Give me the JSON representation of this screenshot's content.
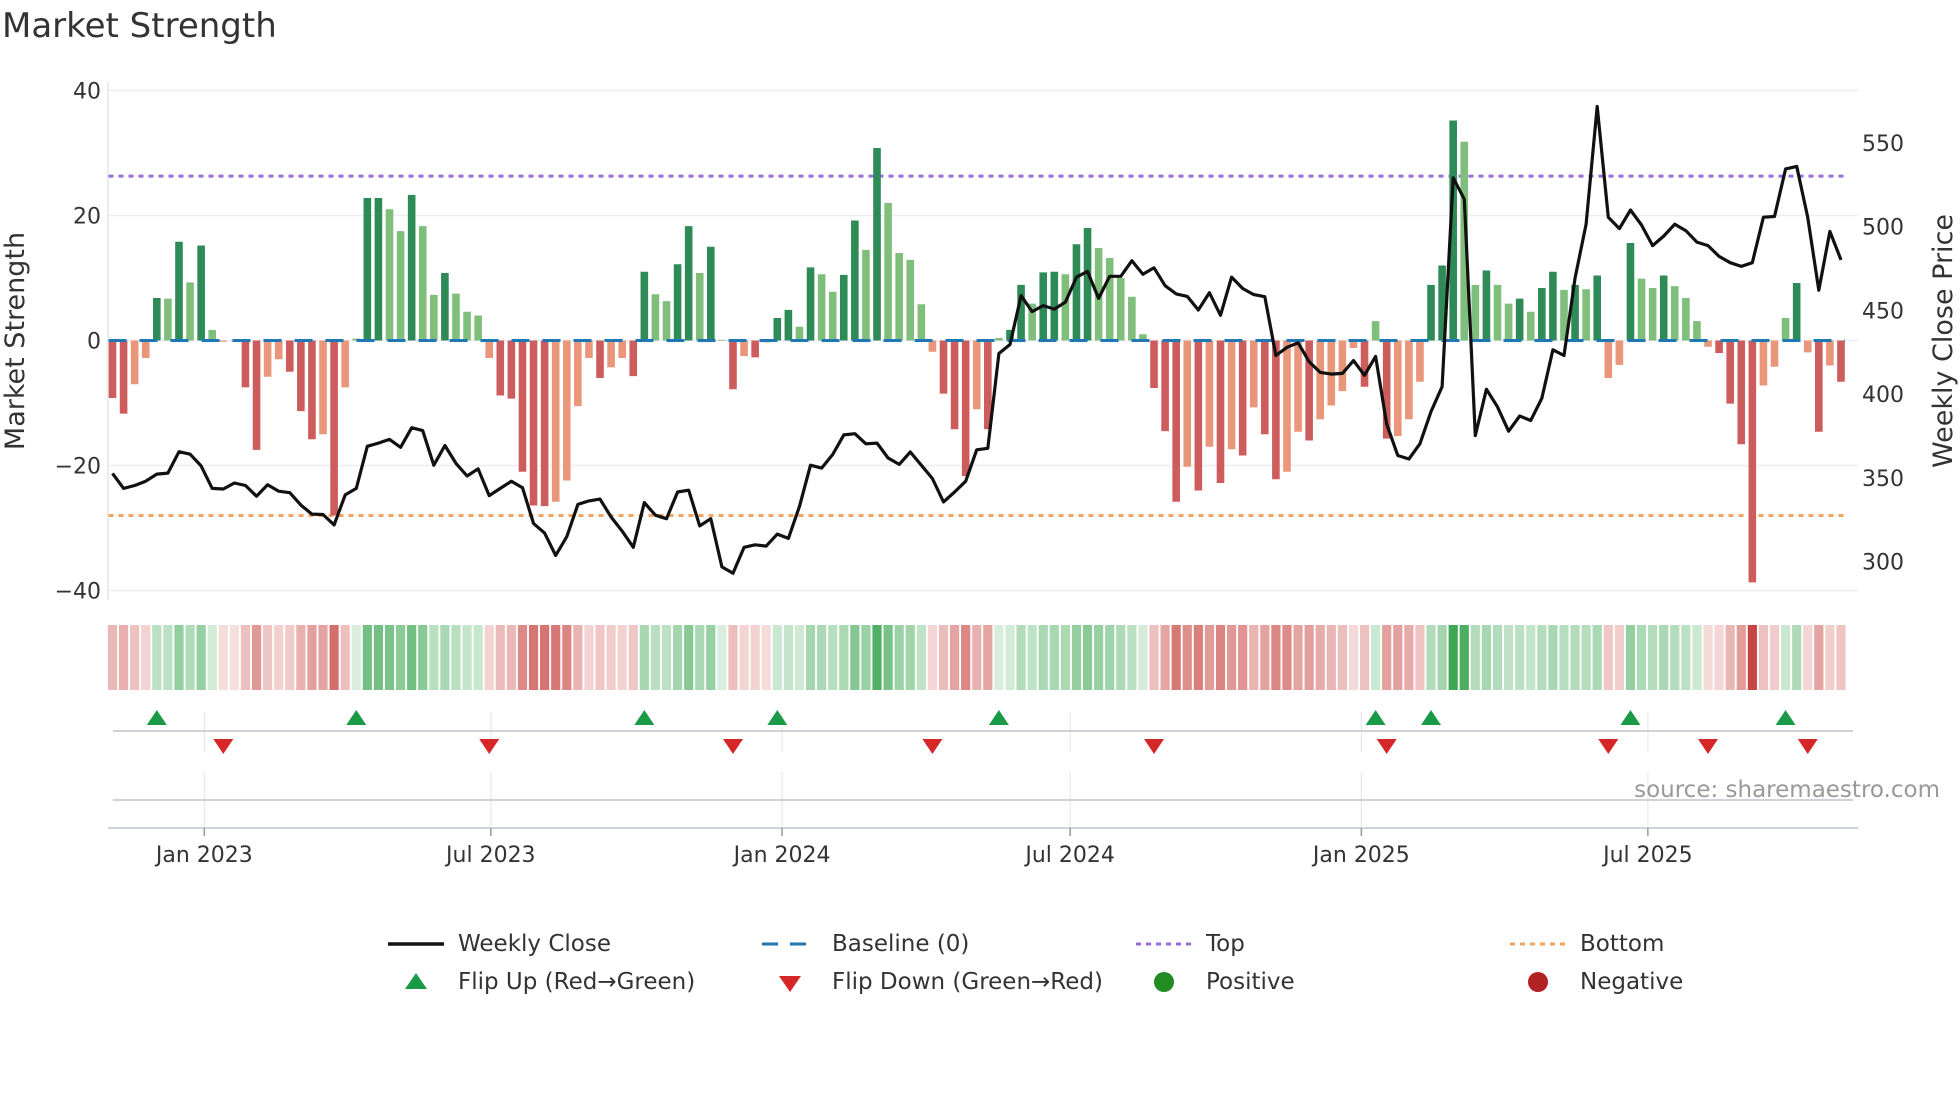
{
  "title": "Market Strength",
  "source": "source: sharemaestro.com",
  "legend": {
    "weekly_close": "Weekly Close",
    "baseline": "Baseline (0)",
    "top": "Top",
    "bottom": "Bottom",
    "flip_up": "Flip Up (Red→Green)",
    "flip_down": "Flip Down (Green→Red)",
    "positive": "Positive",
    "negative": "Negative"
  },
  "colors": {
    "strong_green": "#2e8b57",
    "weak_green": "#7fbf7b",
    "strong_red": "#cd5c5c",
    "weak_red": "#e9967a",
    "line": "#111111",
    "baseline": "#1f77b4",
    "top": "#9b6ee0",
    "bottom": "#f4a460",
    "flip_up": "#1a9a46",
    "flip_down": "#d62728",
    "positive": "#228b22",
    "negative": "#b22222",
    "grid": "#eceef3"
  },
  "chart_data": {
    "type": "bar+line",
    "title": "Market Strength",
    "xlabel": "",
    "ylabel": "Market Strength",
    "y2label": "Weekly Close Price",
    "start_date": "2022-11-04",
    "frequency": "weekly",
    "ylim": [
      -40,
      40
    ],
    "y2lim": [
      283.4,
      581.5
    ],
    "grid": true,
    "legend_position": "bottom",
    "y_ticks": [
      {
        "v": -40,
        "label": "−40"
      },
      {
        "v": -20,
        "label": "−20"
      },
      {
        "v": 0,
        "label": "0"
      },
      {
        "v": 20,
        "label": "20"
      },
      {
        "v": 40,
        "label": "40"
      }
    ],
    "y2_ticks": [
      {
        "v": 300,
        "label": "300"
      },
      {
        "v": 350,
        "label": "350"
      },
      {
        "v": 400,
        "label": "400"
      },
      {
        "v": 450,
        "label": "450"
      },
      {
        "v": 500,
        "label": "500"
      },
      {
        "v": 550,
        "label": "550"
      }
    ],
    "x_ticks": [
      {
        "date": "2023-01-01",
        "label": "Jan 2023"
      },
      {
        "date": "2023-07-01",
        "label": "Jul 2023"
      },
      {
        "date": "2024-01-01",
        "label": "Jan 2024"
      },
      {
        "date": "2024-07-01",
        "label": "Jul 2024"
      },
      {
        "date": "2025-01-01",
        "label": "Jan 2025"
      },
      {
        "date": "2025-07-01",
        "label": "Jul 2025"
      }
    ],
    "top_level": 26.3,
    "bottom_level": -28.0,
    "baseline": 0,
    "strength": [
      -9.2,
      -11.7,
      -7,
      -2.8,
      6.8,
      6.7,
      15.8,
      9.3,
      15.2,
      1.7,
      -0.2,
      -0.1,
      -7.5,
      -17.5,
      -5.8,
      -3,
      -5,
      -11.3,
      -15.8,
      -15,
      -28,
      -7.5,
      0.3,
      22.8,
      22.8,
      21,
      17.5,
      23.3,
      18.3,
      7.3,
      10.8,
      7.5,
      4.6,
      4,
      -2.8,
      -8.8,
      -9.3,
      -21,
      -26.4,
      -26.5,
      -25.8,
      -22.4,
      -10.5,
      -2.8,
      -6,
      -4.3,
      -2.8,
      -5.7,
      11,
      7.4,
      6.3,
      12.2,
      18.3,
      10.8,
      15,
      0.1,
      -7.8,
      -2.5,
      -2.7,
      -0.3,
      3.6,
      4.9,
      2.2,
      11.7,
      10.6,
      7.8,
      10.5,
      19.2,
      14.5,
      30.8,
      22,
      14,
      12.9,
      5.8,
      -1.8,
      -8.5,
      -14.2,
      -21.7,
      -11,
      -14.2,
      0.4,
      1.7,
      8.9,
      5.9,
      10.9,
      11,
      10.6,
      15.4,
      18,
      14.8,
      13.2,
      10,
      7,
      1,
      -7.6,
      -14.5,
      -25.8,
      -20.2,
      -24,
      -17,
      -22.8,
      -17.4,
      -18.4,
      -10.7,
      -15,
      -22.2,
      -21,
      -14.6,
      -16,
      -12.6,
      -10.4,
      -8.1,
      -1.2,
      -7.4,
      3.1,
      -15.7,
      -15.3,
      -12.6,
      -6.6,
      8.9,
      12,
      35.2,
      31.8,
      8.9,
      11.2,
      8.9,
      5.9,
      6.7,
      4.6,
      8.4,
      11,
      8.1,
      8.9,
      8.2,
      10.4,
      -6,
      -3.9,
      15.6,
      9.9,
      8.4,
      10.4,
      8.7,
      6.8,
      3.1,
      -1,
      -2,
      -10.1,
      -16.6,
      -38.7,
      -7.2,
      -4.2,
      3.6,
      9.2,
      -1.9,
      -14.6,
      -4,
      -6.6
    ],
    "weekly_close": [
      352.6,
      343.7,
      345.4,
      348,
      352.2,
      352.8,
      365.6,
      364.1,
      357.1,
      343.7,
      343.3,
      346.9,
      345.4,
      339,
      345.8,
      342,
      341.1,
      333.7,
      328.3,
      328.1,
      321.9,
      339.8,
      343.7,
      368.8,
      370.7,
      372.9,
      368.2,
      379.9,
      378.2,
      357.5,
      369.3,
      358.6,
      351.1,
      355.4,
      339.4,
      343.7,
      348,
      344.1,
      322.8,
      317,
      303.6,
      314.9,
      334.1,
      336.2,
      337.3,
      326.6,
      318.1,
      308.5,
      335.2,
      327.7,
      325.6,
      341.5,
      342.6,
      321.3,
      325.6,
      296.8,
      293,
      308.5,
      310,
      309.2,
      316.4,
      313.8,
      333,
      357.5,
      355.8,
      363.9,
      375.6,
      376.3,
      370.3,
      370.7,
      361.8,
      358,
      365.4,
      357.5,
      349.6,
      335.6,
      341.5,
      348,
      366.7,
      367.6,
      424.2,
      429.6,
      458.8,
      449.2,
      452.8,
      450.7,
      454.9,
      469.8,
      473.2,
      457.1,
      470.3,
      470.3,
      479.6,
      471.5,
      475.4,
      464.7,
      459.8,
      458.3,
      450.2,
      460.5,
      447,
      469.8,
      463,
      459.4,
      458.1,
      423,
      427.9,
      430.6,
      419.3,
      412.9,
      411.9,
      412.3,
      420,
      411.2,
      422.5,
      382,
      363.3,
      361.2,
      370.3,
      389.5,
      404.4,
      529.1,
      516.3,
      375.2,
      402.9,
      392.3,
      377.8,
      386.9,
      384.2,
      397.4,
      426.4,
      423,
      469.4,
      501.4,
      571.7,
      505.6,
      498.8,
      509.9,
      500.9,
      488.6,
      494.3,
      501.4,
      497.5,
      490.7,
      488.6,
      482.2,
      478.4,
      476.2,
      478.4,
      505.6,
      506,
      534.4,
      535.9,
      505.6,
      462,
      497.1,
      480.1
    ],
    "flip_up_weeks": [
      4,
      22,
      48,
      60,
      80,
      114,
      119,
      137,
      151
    ],
    "flip_down_weeks": [
      10,
      34,
      56,
      74,
      94,
      115,
      135,
      144,
      153
    ]
  }
}
